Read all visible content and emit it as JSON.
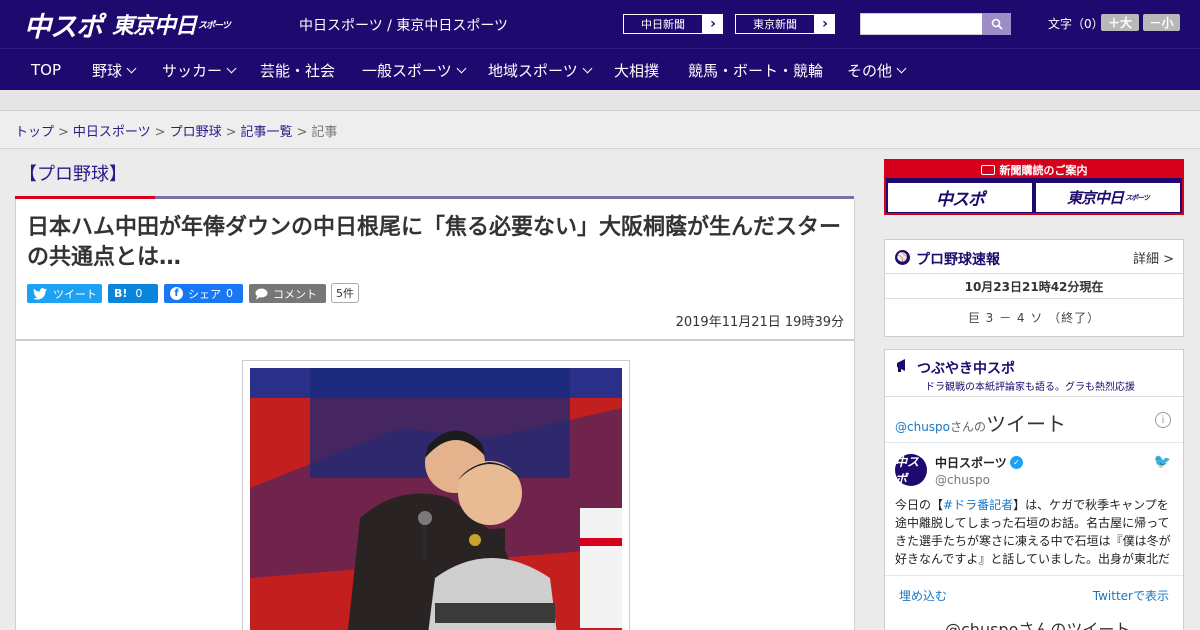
{
  "header": {
    "logo_chuspo": "中スポ",
    "logo_tokyo": "東京中日",
    "logo_tokyo_small": "スポーツ",
    "site_name": "中日スポーツ / 東京中日スポーツ",
    "paper_links": [
      {
        "label": "中日新聞"
      },
      {
        "label": "東京新聞"
      }
    ],
    "search_placeholder": "",
    "font_size_label": "文字（0）",
    "font_larger": "＋大",
    "font_smaller": "－小"
  },
  "nav": [
    {
      "label": "TOP",
      "dropdown": false
    },
    {
      "label": "野球",
      "dropdown": true
    },
    {
      "label": "サッカー",
      "dropdown": true
    },
    {
      "label": "芸能・社会",
      "dropdown": false
    },
    {
      "label": "一般スポーツ",
      "dropdown": true
    },
    {
      "label": "地域スポーツ",
      "dropdown": true
    },
    {
      "label": "大相撲",
      "dropdown": false
    },
    {
      "label": "競馬・ボート・競輪",
      "dropdown": false
    },
    {
      "label": "その他",
      "dropdown": true
    }
  ],
  "breadcrumb": {
    "items": [
      "トップ",
      "中日スポーツ",
      "プロ野球",
      "記事一覧"
    ],
    "current": "記事",
    "separator": ">"
  },
  "article": {
    "category": "【プロ野球】",
    "headline": "日本ハム中田が年俸ダウンの中日根尾に「焦る必要ない」大阪桐蔭が生んだスターの共通点とは…",
    "share": {
      "tweet": "ツイート",
      "hatena_icon": "B!",
      "hatena_count": "0",
      "facebook": "シェア",
      "facebook_count": "0",
      "comment": "コメント",
      "comment_count": "5件"
    },
    "date": "2019年11月21日 19時39分"
  },
  "sidebar": {
    "subscription": {
      "title": "新聞購読のご案内",
      "logo_left": "中スポ",
      "logo_right": "東京中日",
      "logo_right_small": "スポーツ"
    },
    "score": {
      "title": "プロ野球速報",
      "detail": "詳細 >",
      "time": "10月23日21時42分現在",
      "line": "巨 3 － 4 ソ （終了）"
    },
    "tweets": {
      "title": "つぶやき中スポ",
      "subtitle": "ドラ観戦の本紙評論家も語る。グラも熱烈応援",
      "tab_handle": "@chuspo",
      "tab_san": "さんの",
      "tab_word": "ツイート",
      "info": "i",
      "user_name": "中日スポーツ",
      "user_handle": "@chuspo",
      "avatar_text": "中スポ",
      "text_before": "今日の【",
      "hashtag": "#ドラ番記者",
      "text_after": "】は、ケガで秋季キャンプを途中離脱してしまった石垣のお話。名古屋に帰ってきた選手たちが寒さに凍える中で石垣は『僕は冬が好きなんですよ』と話していました。出身が東北だ",
      "embed": "埋め込む",
      "view_on_twitter": "Twitterで表示",
      "bottom_text": "@chuspoさんのツイート"
    }
  },
  "colors": {
    "brand_navy": "#1e0a6e",
    "accent_red": "#d6001c",
    "link_blue": "#2b1a8a"
  }
}
